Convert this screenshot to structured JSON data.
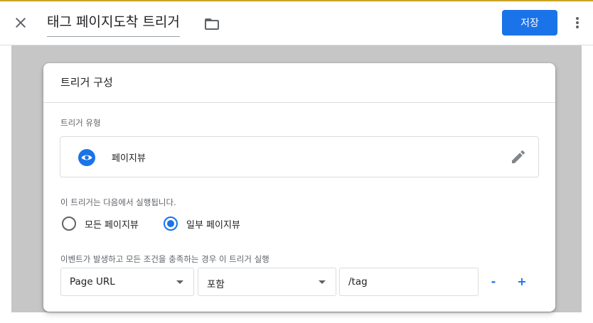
{
  "header": {
    "title": "태그 페이지도착 트리거",
    "save_label": "저장"
  },
  "card": {
    "title": "트리거 구성",
    "trigger_type_label": "트리거 유형",
    "trigger_type_value": "페이지뷰",
    "fires_on_label": "이 트리거는 다음에서 실행됩니다.",
    "radio_options": [
      {
        "label": "모든 페이지뷰",
        "checked": false
      },
      {
        "label": "일부 페이지뷰",
        "checked": true
      }
    ],
    "condition_label": "이벤트가 발생하고 모든 조건을 충족하는 경우 이 트리거 실행",
    "condition": {
      "variable": "Page URL",
      "operator": "포함",
      "value": "/tag"
    },
    "remove_label": "-",
    "add_label": "+"
  },
  "colors": {
    "accent": "#1a73e8",
    "top_stripe": "#c8a427",
    "backdrop": "#c6c6c6"
  },
  "icons": {
    "close": "close-icon",
    "folder": "folder-icon",
    "more": "more-vert-icon",
    "trigger_type": "eye-icon",
    "edit": "pencil-icon"
  }
}
